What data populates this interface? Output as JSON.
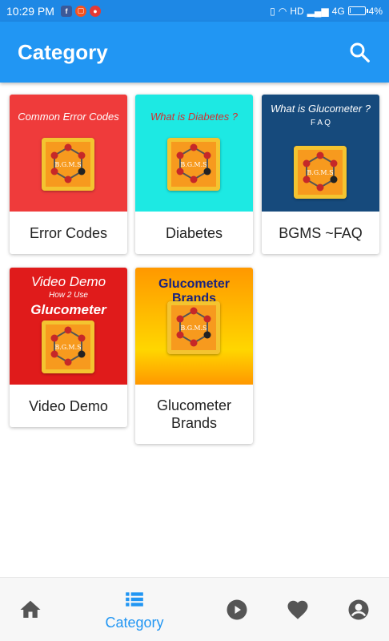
{
  "status_bar": {
    "time": "10:29 PM",
    "network": "HD",
    "signal": "4G",
    "battery_text": "4%",
    "battery_level": 0.04,
    "notification_icons": [
      "facebook-icon",
      "app-notification-icon",
      "microphone-icon"
    ]
  },
  "app_bar": {
    "title": "Category",
    "search_icon": "search-icon"
  },
  "categories": [
    {
      "label": "Error Codes",
      "headline": "Common Error Codes",
      "subheadline": "",
      "bg": "#ef3b3b",
      "headline_color": "#ffffff"
    },
    {
      "label": "Diabetes",
      "headline": "What is Diabetes ?",
      "subheadline": "",
      "bg": "#1de9e3",
      "headline_color": "#d32f2f"
    },
    {
      "label": "BGMS ~FAQ",
      "headline": "What is Glucometer ?",
      "subheadline": "F A Q",
      "bg": "#164a7c",
      "headline_color": "#ffffff"
    },
    {
      "label": "Video Demo",
      "headline": "Video Demo",
      "subheadline": "How 2 Use",
      "headline2": "Glucometer",
      "bg": "#e01b1b",
      "headline_color": "#ffffff"
    },
    {
      "label": "Glucometer Brands",
      "label_line1": "Glucometer",
      "label_line2": "Brands",
      "headline": "Glucometer Brands",
      "subheadline": "",
      "bg": "gradient-orange-yellow",
      "headline_color": "#1a237e"
    }
  ],
  "logo_text": "B.G.M.S",
  "bottom_nav": {
    "items": [
      {
        "icon": "home-icon",
        "label": "",
        "active": false
      },
      {
        "icon": "category-list-icon",
        "label": "Category",
        "active": true
      },
      {
        "icon": "play-icon",
        "label": "",
        "active": false
      },
      {
        "icon": "heart-icon",
        "label": "",
        "active": false
      },
      {
        "icon": "account-icon",
        "label": "",
        "active": false
      }
    ]
  },
  "colors": {
    "primary": "#2196f3",
    "status_bar": "#1e88e5",
    "icon_gray": "#555555"
  }
}
